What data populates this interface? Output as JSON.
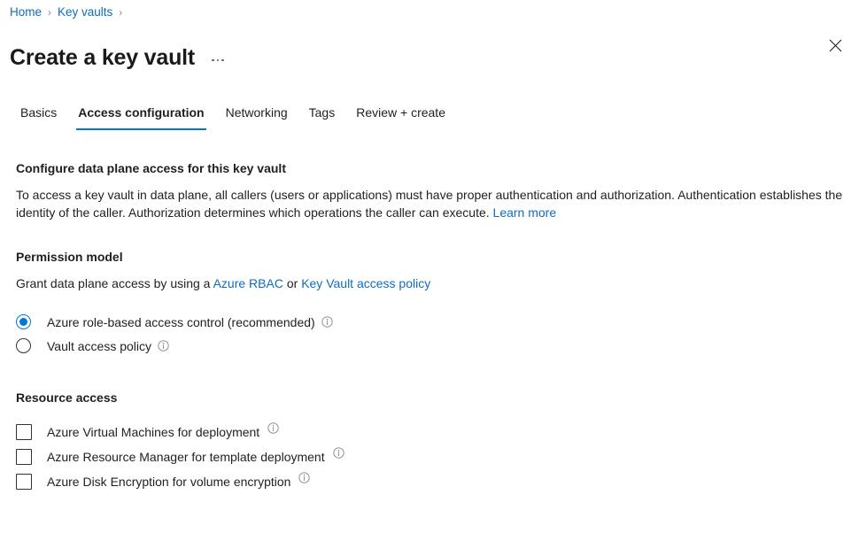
{
  "breadcrumb": {
    "items": [
      {
        "label": "Home"
      },
      {
        "label": "Key vaults"
      }
    ],
    "separator": "›"
  },
  "header": {
    "title": "Create a key vault",
    "more_actions_label": "More actions",
    "close_label": "Close",
    "close_icon": "close-icon"
  },
  "tabs": [
    {
      "label": "Basics",
      "active": false
    },
    {
      "label": "Access configuration",
      "active": true
    },
    {
      "label": "Networking",
      "active": false
    },
    {
      "label": "Tags",
      "active": false
    },
    {
      "label": "Review + create",
      "active": false
    }
  ],
  "main": {
    "section_heading": "Configure data plane access for this key vault",
    "description_part1": "To access a key vault in data plane, all callers (users or applications) must have proper authentication and authorization. Authentication establishes the identity of the caller. Authorization determines which operations the caller can execute. ",
    "learn_more_label": "Learn more",
    "permission_model": {
      "heading": "Permission model",
      "description_prefix": "Grant data plane access by using a ",
      "link_rbac": "Azure RBAC",
      "description_middle": " or ",
      "link_access_policy": "Key Vault access policy",
      "options": [
        {
          "label": "Azure role-based access control (recommended)",
          "selected": true,
          "info": "info-icon"
        },
        {
          "label": "Vault access policy",
          "selected": false,
          "info": "info-icon"
        }
      ]
    },
    "resource_access": {
      "heading": "Resource access",
      "options": [
        {
          "label": "Azure Virtual Machines for deployment",
          "checked": false,
          "info": "info-icon"
        },
        {
          "label": "Azure Resource Manager for template deployment",
          "checked": false,
          "info": "info-icon"
        },
        {
          "label": "Azure Disk Encryption for volume encryption",
          "checked": false,
          "info": "info-icon"
        }
      ]
    }
  },
  "colors": {
    "link": "#0f6cbd",
    "accent": "#0078d4",
    "text": "#201f1e",
    "muted": "#605e5c",
    "background": "#ffffff"
  }
}
